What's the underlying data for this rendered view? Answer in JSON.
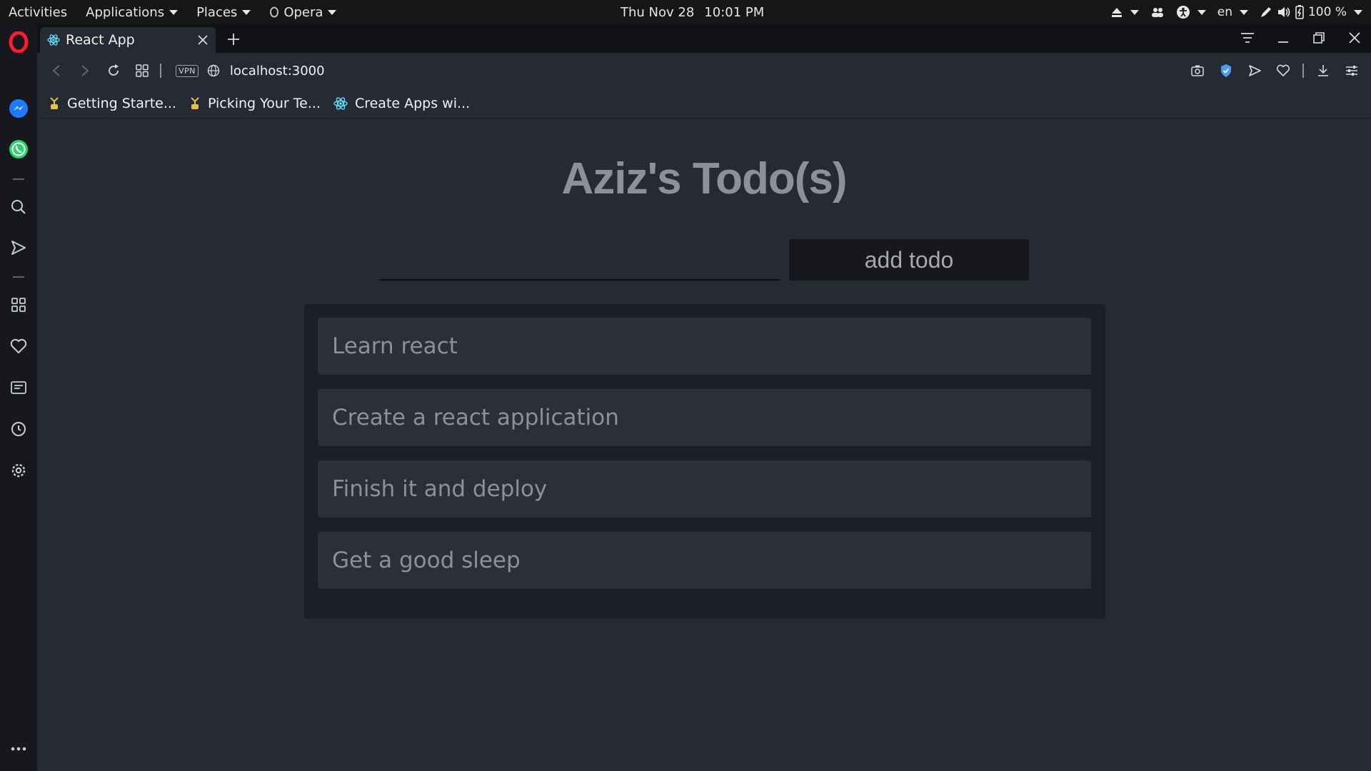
{
  "system_bar": {
    "activities": "Activities",
    "applications": "Applications",
    "places": "Places",
    "opera": "Opera",
    "date": "Thu Nov 28",
    "time": "10:01 PM",
    "language": "en",
    "battery": "100 %"
  },
  "browser": {
    "tab_title": "React App",
    "url": "localhost:3000",
    "vpn_label": "VPN",
    "bookmarks": [
      {
        "label": "Getting Starte..."
      },
      {
        "label": "Picking Your Te..."
      },
      {
        "label": "Create Apps wi..."
      }
    ]
  },
  "app": {
    "title": "Aziz's Todo(s)",
    "input_value": "",
    "add_button_label": "add todo",
    "todos": [
      {
        "text": "Learn react"
      },
      {
        "text": "Create a react application"
      },
      {
        "text": "Finish it and deploy"
      },
      {
        "text": "Get a good sleep"
      }
    ]
  },
  "colors": {
    "opera_red": "#ff1b2d",
    "messenger_blue": "#1e7bff",
    "whatsapp_green": "#25d366",
    "react_teal": "#61dafb",
    "shield_blue": "#4a9cf6"
  }
}
